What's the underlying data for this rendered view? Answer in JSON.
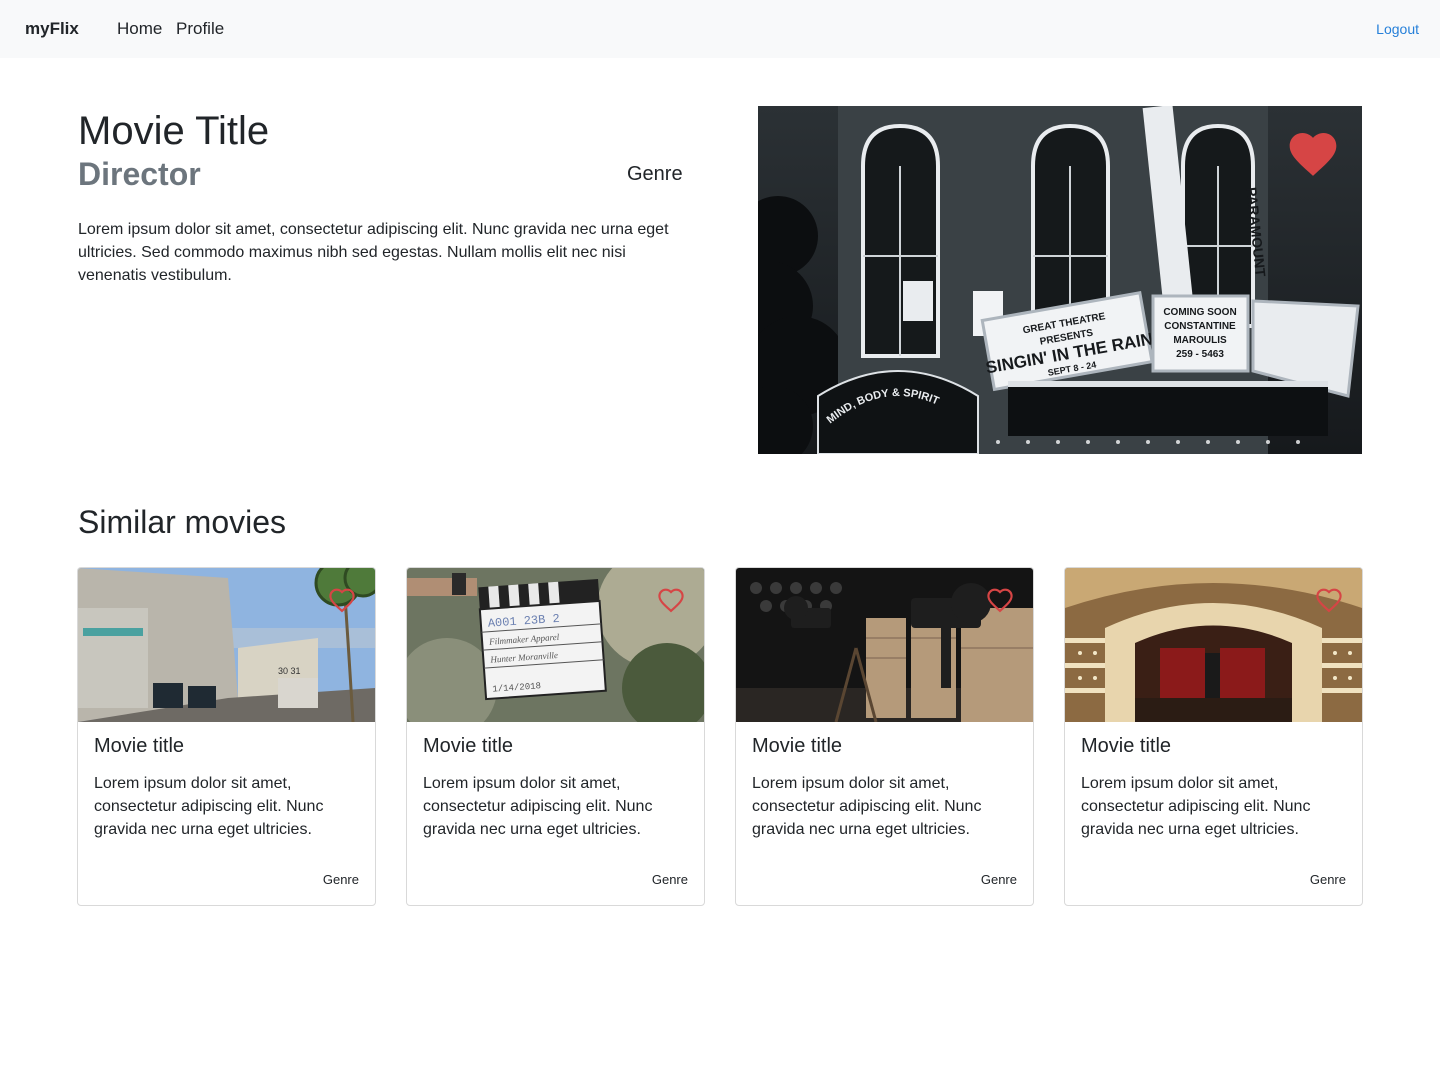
{
  "nav": {
    "brand": "myFlix",
    "links": [
      "Home",
      "Profile"
    ],
    "logout": "Logout"
  },
  "movie": {
    "title": "Movie Title",
    "director": "Director",
    "genre": "Genre",
    "description": "Lorem ipsum dolor sit amet, consectetur adipiscing elit. Nunc gravida nec urna eget ultricies. Sed commodo maximus nibh sed egestas. Nullam mollis elit nec nisi venenatis vestibulum.",
    "favorite": true,
    "image_signs": {
      "marquee_left": [
        "GREAT THEATRE",
        "PRESENTS",
        "SINGIN' IN THE RAIN",
        "SEPT 8 - 24"
      ],
      "marquee_right": [
        "COMING SOON",
        "CONSTANTINE",
        "MAROULIS",
        "259 - 5463"
      ],
      "vertical_sign": "PARAMOUNT",
      "arch_sign": "MIND, BODY & SPIRIT"
    }
  },
  "similar": {
    "heading": "Similar movies",
    "cards": [
      {
        "title": "Movie title",
        "text": "Lorem ipsum dolor sit amet, consectetur adipiscing elit. Nunc gravida nec urna eget ultricies.",
        "genre": "Genre",
        "favorite": false,
        "image": "studio-backlot"
      },
      {
        "title": "Movie title",
        "text": "Lorem ipsum dolor sit amet, consectetur adipiscing elit. Nunc gravida nec urna eget ultricies.",
        "genre": "Genre",
        "favorite": false,
        "image": "clapperboard"
      },
      {
        "title": "Movie title",
        "text": "Lorem ipsum dolor sit amet, consectetur adipiscing elit. Nunc gravida nec urna eget ultricies.",
        "genre": "Genre",
        "favorite": false,
        "image": "film-cameras"
      },
      {
        "title": "Movie title",
        "text": "Lorem ipsum dolor sit amet, consectetur adipiscing elit. Nunc gravida nec urna eget ultricies.",
        "genre": "Genre",
        "favorite": false,
        "image": "theater-interior"
      }
    ]
  },
  "colors": {
    "navbar_bg": "#f8f9fa",
    "link": "#2680d9",
    "muted": "#6c757d",
    "heart": "#d64545"
  },
  "icons": {
    "favorite": "heart-icon"
  }
}
